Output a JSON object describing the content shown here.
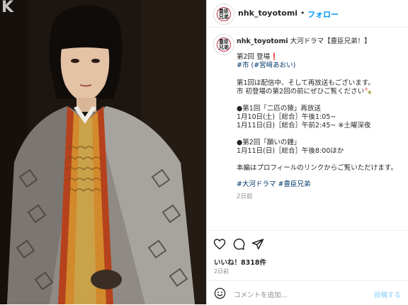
{
  "watermark": "K",
  "post": {
    "username": "nhk_toyotomi",
    "follow_label": "フォロー",
    "header_separator": "•",
    "avatar_label": "豊臣兄弟"
  },
  "caption": {
    "username": "nhk_toyotomi",
    "lines": {
      "title": "大河ドラマ【豊臣兄弟！】",
      "l1": "第2回 登場❗️",
      "l2_tag1": "#市",
      "l2_tag2_open": " (",
      "l2_tag2": "#宮﨑あおい",
      "l2_tag2_close": ")",
      "l3": "第1回は配信中、そして再放送もございます。",
      "l4": "市 初登場の第2回の前にぜひご覧ください🍡",
      "l5": "●第1回「二匹の猿」再放送",
      "l6": "1月10日(土)［総合］午後1:05~",
      "l7": "1月11日(日)［総合］午前2:45~ ※土曜深夜",
      "l8": "●第2回「願いの鐘」",
      "l9": "1月11日(日)［総合］午後8:00ほか",
      "l10": "本編はプロフィールのリンクからご覧いただけます。",
      "hashtag1": "#大河ドラマ",
      "hashtag2": "#豊臣兄弟",
      "time_ago": "2日前"
    }
  },
  "actions": {
    "like_icon": "heart-icon",
    "comment_icon": "comment-icon",
    "share_icon": "send-icon",
    "likes_text": "いいね！8318件",
    "date_text": "2日前"
  },
  "comment_box": {
    "emoji_icon": "smiley-icon",
    "placeholder": "コメントを追加...",
    "post_label": "投稿する"
  },
  "colors": {
    "link": "#00376b",
    "follow": "#0095f6",
    "heart": "#e0245e"
  }
}
